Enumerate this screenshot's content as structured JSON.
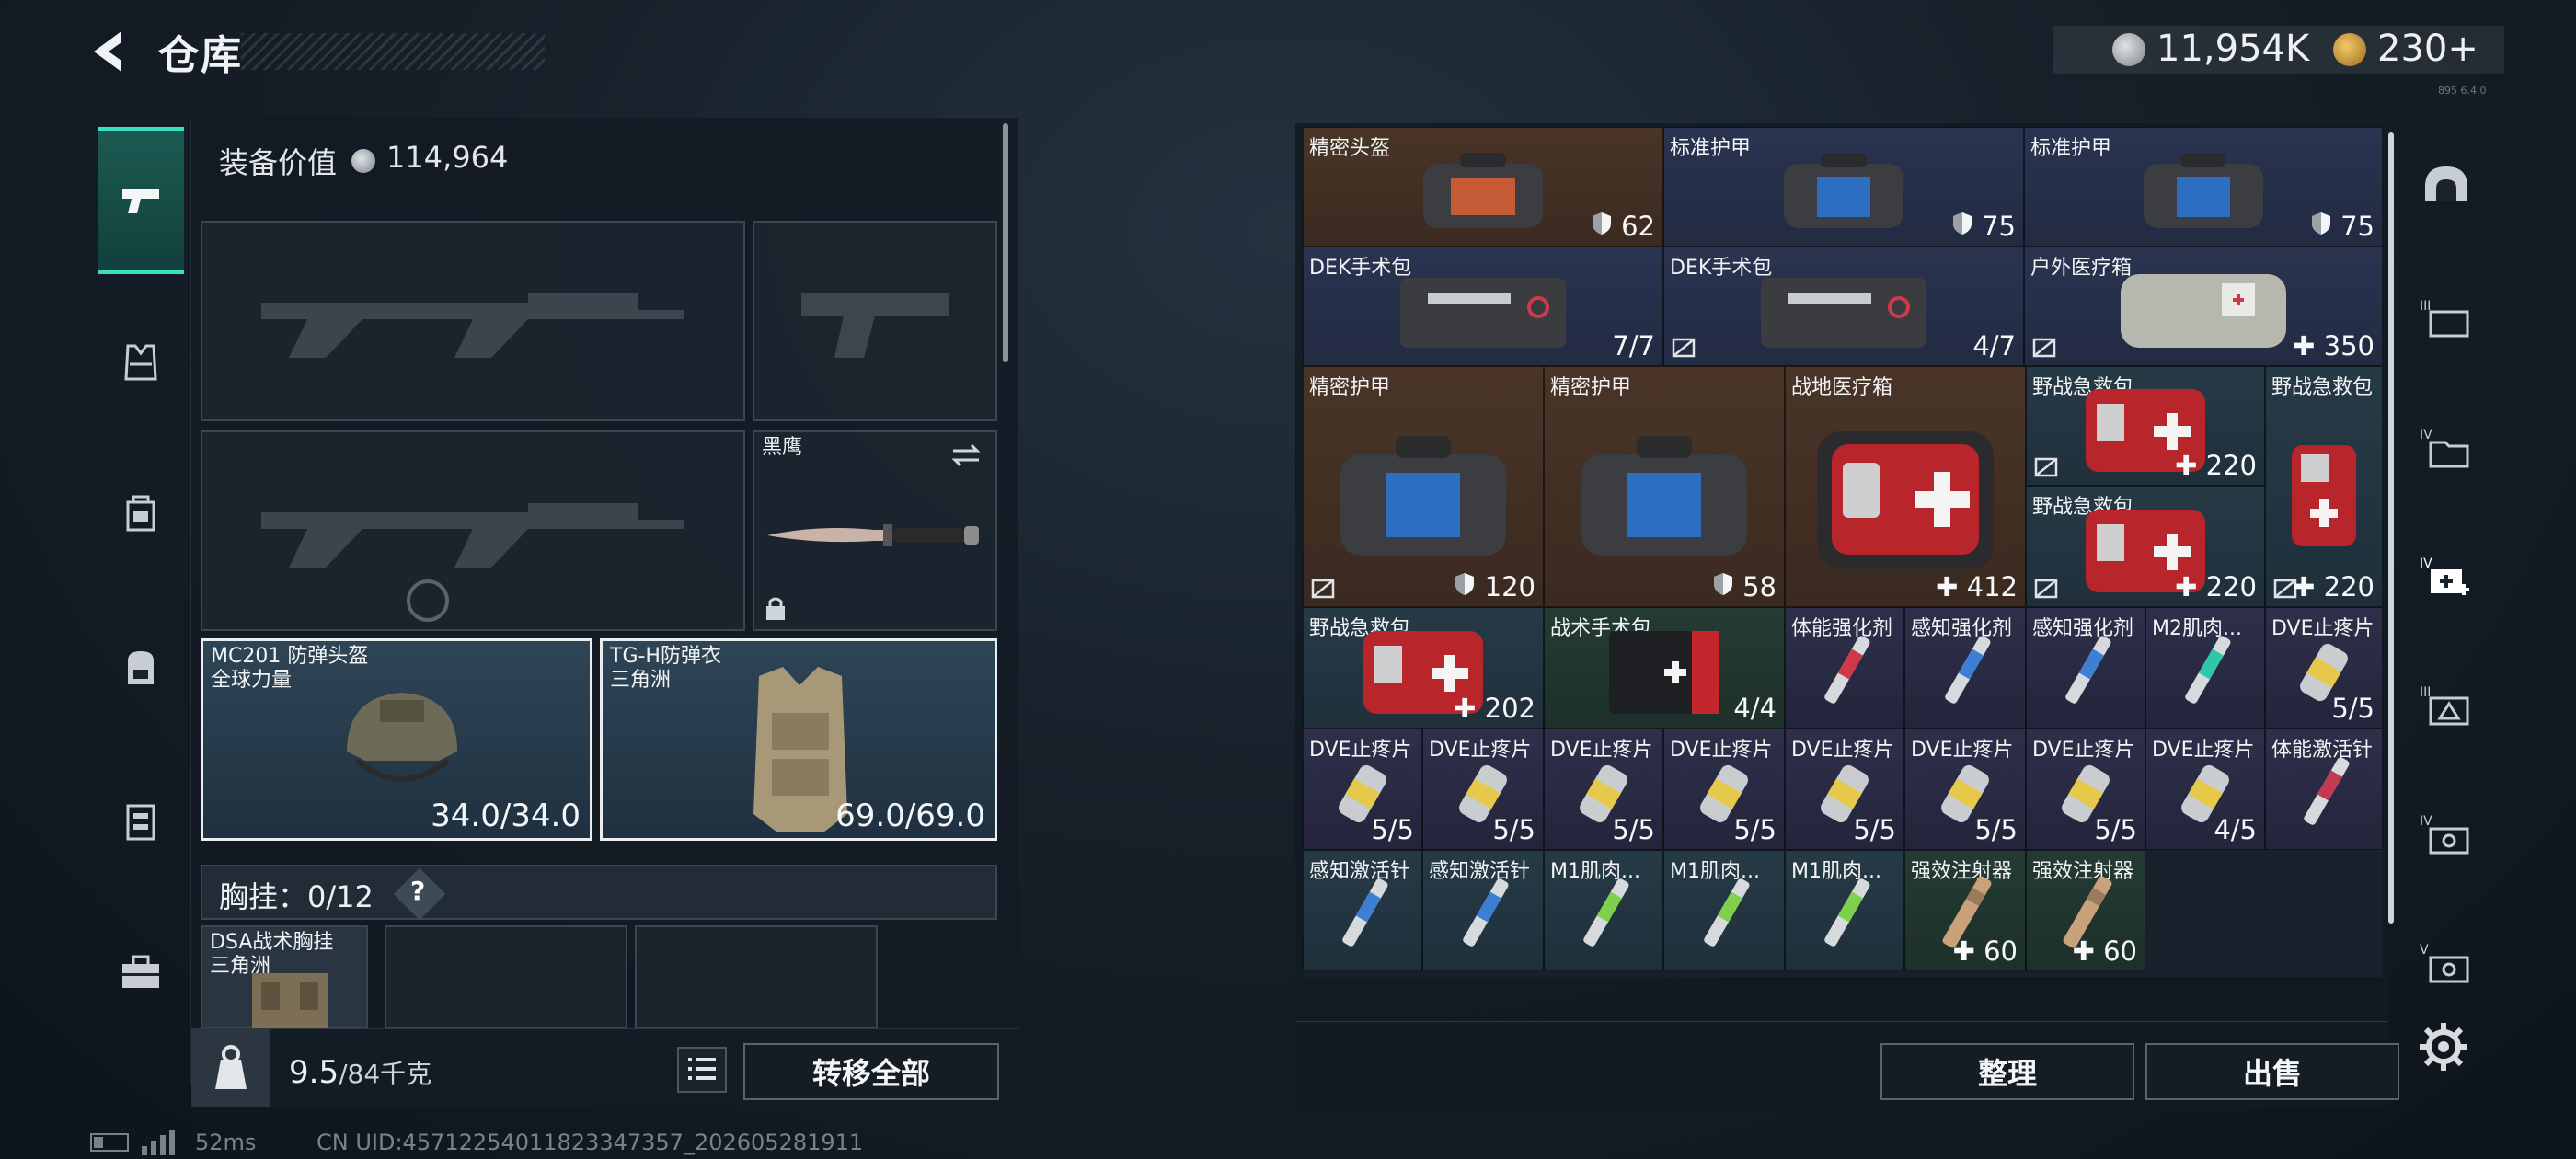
{
  "header": {
    "title": "仓库"
  },
  "currency": {
    "silver": "11,954K",
    "gold": "230",
    "gold_plus": "+"
  },
  "build_tag": "895 6.4.0",
  "sidebar": {
    "tabs": [
      {
        "name": "weapons",
        "active": true
      },
      {
        "name": "armor"
      },
      {
        "name": "rig"
      },
      {
        "name": "backpack"
      },
      {
        "name": "container"
      },
      {
        "name": "toolbox"
      }
    ]
  },
  "loadout": {
    "value_label": "装备价值",
    "value": "114,964",
    "knife": {
      "name": "黑鹰"
    },
    "helmet": {
      "name": "MC201 防弹头盔",
      "faction": "全球力量",
      "durability": "34.0/34.0"
    },
    "armor": {
      "name": "TG-H防弹衣",
      "faction": "三角洲",
      "durability": "69.0/69.0"
    },
    "rig_label": "胸挂",
    "rig_count": "0/12",
    "rig_help": "?",
    "rig_item": {
      "name": "DSA战术胸挂",
      "faction": "三角洲"
    },
    "weight": "9.5",
    "weight_unit": "/84千克",
    "transfer_all": "转移全部"
  },
  "status": {
    "ping": "52ms",
    "uid": "CN UID:45712254011823347357_202605281911"
  },
  "stash": {
    "items": [
      {
        "name": "精密头盔",
        "value": "62"
      },
      {
        "name": "标准护甲",
        "value": "75"
      },
      {
        "name": "标准护甲",
        "value": "75"
      },
      {
        "name": "DEK手术包",
        "value": "7/7"
      },
      {
        "name": "DEK手术包",
        "value": "4/7"
      },
      {
        "name": "户外医疗箱",
        "value": "350"
      },
      {
        "name": "精密护甲",
        "value": "120"
      },
      {
        "name": "精密护甲",
        "value": "58"
      },
      {
        "name": "战地医疗箱",
        "value": "412"
      },
      {
        "name": "野战急救包",
        "value": "220"
      },
      {
        "name": "野战急救包",
        "value": "220"
      },
      {
        "name": "野战急救包",
        "value": "220"
      },
      {
        "name": "野战急救包",
        "value": "202"
      },
      {
        "name": "战术手术包",
        "value": "4/4"
      },
      {
        "name": "体能强化剂",
        "value": ""
      },
      {
        "name": "感知强化剂",
        "value": ""
      },
      {
        "name": "感知强化剂",
        "value": ""
      },
      {
        "name": "M2肌肉...",
        "value": ""
      },
      {
        "name": "DVE止疼片",
        "value": "5/5"
      },
      {
        "name": "DVE止疼片",
        "value": "5/5"
      },
      {
        "name": "DVE止疼片",
        "value": "5/5"
      },
      {
        "name": "DVE止疼片",
        "value": "5/5"
      },
      {
        "name": "DVE止疼片",
        "value": "5/5"
      },
      {
        "name": "DVE止疼片",
        "value": "5/5"
      },
      {
        "name": "DVE止疼片",
        "value": "5/5"
      },
      {
        "name": "DVE止疼片",
        "value": "5/5"
      },
      {
        "name": "DVE止疼片",
        "value": "4/5"
      },
      {
        "name": "体能激活针",
        "value": ""
      },
      {
        "name": "感知激活针",
        "value": ""
      },
      {
        "name": "感知激活针",
        "value": ""
      },
      {
        "name": "M1肌肉...",
        "value": ""
      },
      {
        "name": "M1肌肉...",
        "value": ""
      },
      {
        "name": "M1肌肉...",
        "value": ""
      },
      {
        "name": "强效注射器",
        "value": "60"
      },
      {
        "name": "强效注射器",
        "value": "60"
      }
    ],
    "sort_label": "整理",
    "sell_label": "出售"
  },
  "right_sidebar": {
    "tabs": [
      "helmet-category",
      "III-armor",
      "IV-storage",
      "IV-medical",
      "III-rig",
      "IV-stash",
      "V-stash"
    ]
  },
  "colors": {
    "accent": "#36e0c0",
    "panel": "#121a22"
  }
}
